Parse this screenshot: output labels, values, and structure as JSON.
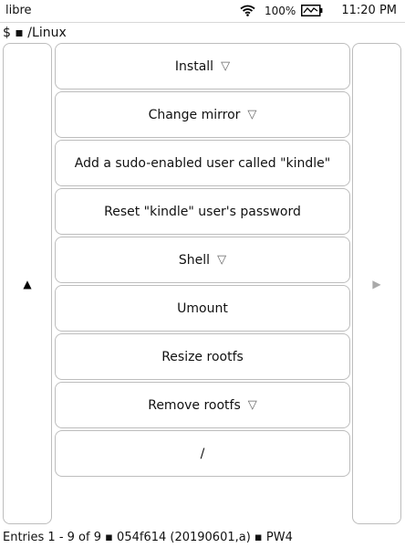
{
  "status": {
    "device_name": "libre",
    "battery_percent": "100%",
    "time": "11:20 PM"
  },
  "path": "$ ▪ /Linux",
  "nav": {
    "prev_arrow": "▲",
    "next_arrow": "▶"
  },
  "menu": {
    "items": [
      {
        "label": "Install",
        "caret": "▽"
      },
      {
        "label": "Change mirror",
        "caret": "▽"
      },
      {
        "label": "Add a sudo-enabled user called \"kindle\"",
        "caret": ""
      },
      {
        "label": "Reset \"kindle\" user's password",
        "caret": ""
      },
      {
        "label": "Shell",
        "caret": "▽"
      },
      {
        "label": "Umount",
        "caret": ""
      },
      {
        "label": "Resize rootfs",
        "caret": ""
      },
      {
        "label": "Remove rootfs",
        "caret": "▽"
      },
      {
        "label": "/",
        "caret": ""
      }
    ]
  },
  "footer": "Entries 1 - 9 of 9 ▪ 054f614 (20190601,a) ▪ PW4",
  "colors": {
    "border": "#bdbdbd",
    "disabled_arrow": "#a9a9a9"
  },
  "icons": [
    "wifi-icon",
    "battery-charging-icon"
  ]
}
